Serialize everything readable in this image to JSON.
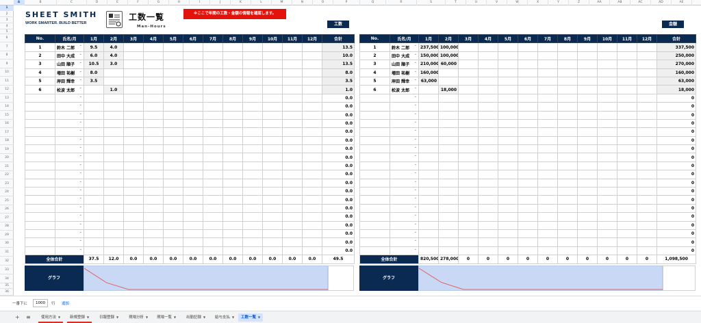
{
  "column_headers": [
    "A",
    "B",
    "C",
    "D",
    "E",
    "F",
    "G",
    "H",
    "I",
    "J",
    "K",
    "L",
    "M",
    "N",
    "O",
    "P",
    "Q",
    "R",
    "S",
    "T",
    "U",
    "V",
    "W",
    "X",
    "Y",
    "Z",
    "AA",
    "AB",
    "AC",
    "AD",
    "AE",
    "AF"
  ],
  "row_count": 36,
  "brand": {
    "name": "SHEET SMITH",
    "tagline": "WORK SMARTER. BUILD BETTER"
  },
  "page_title": {
    "ja": "工数一覧",
    "en": "Man-Hours"
  },
  "notice": "※ここで年間の工数・金額の情報を確認します。",
  "left_tag": "工数",
  "right_tag": "金額",
  "headers": {
    "no": "No.",
    "name": "氏名/月",
    "months": [
      "1月",
      "2月",
      "3月",
      "4月",
      "5月",
      "6月",
      "7月",
      "8月",
      "9月",
      "10月",
      "11月",
      "12月"
    ],
    "total": "合計"
  },
  "hours_rows": [
    {
      "no": "1",
      "name": "鈴木 二郎",
      "m": [
        "9.5",
        "4.0",
        "",
        "",
        "",
        "",
        "",
        "",
        "",
        "",
        "",
        ""
      ],
      "total": "13.5"
    },
    {
      "no": "2",
      "name": "田中 大成",
      "m": [
        "6.0",
        "4.0",
        "",
        "",
        "",
        "",
        "",
        "",
        "",
        "",
        "",
        ""
      ],
      "total": "10.0"
    },
    {
      "no": "3",
      "name": "山田 順子",
      "m": [
        "10.5",
        "3.0",
        "",
        "",
        "",
        "",
        "",
        "",
        "",
        "",
        "",
        ""
      ],
      "total": "13.5"
    },
    {
      "no": "4",
      "name": "増田 祐樹",
      "m": [
        "8.0",
        "",
        "",
        "",
        "",
        "",
        "",
        "",
        "",
        "",
        "",
        ""
      ],
      "total": "8.0"
    },
    {
      "no": "5",
      "name": "岸田 輝幸",
      "m": [
        "3.5",
        "",
        "",
        "",
        "",
        "",
        "",
        "",
        "",
        "",
        "",
        ""
      ],
      "total": "3.5"
    },
    {
      "no": "6",
      "name": "松波 太郎",
      "m": [
        "",
        "1.0",
        "",
        "",
        "",
        "",
        "",
        "",
        "",
        "",
        "",
        ""
      ],
      "total": "1.0"
    }
  ],
  "hours_empty_total": "0.0",
  "amount_rows": [
    {
      "no": "1",
      "name": "鈴木 二郎",
      "m": [
        "237,500",
        "100,000",
        "",
        "",
        "",
        "",
        "",
        "",
        "",
        "",
        "",
        ""
      ],
      "total": "337,500"
    },
    {
      "no": "2",
      "name": "田中 大成",
      "m": [
        "150,000",
        "100,000",
        "",
        "",
        "",
        "",
        "",
        "",
        "",
        "",
        "",
        ""
      ],
      "total": "250,000"
    },
    {
      "no": "3",
      "name": "山田 順子",
      "m": [
        "210,000",
        "60,000",
        "",
        "",
        "",
        "",
        "",
        "",
        "",
        "",
        "",
        ""
      ],
      "total": "270,000"
    },
    {
      "no": "4",
      "name": "増田 祐樹",
      "m": [
        "160,000",
        "",
        "",
        "",
        "",
        "",
        "",
        "",
        "",
        "",
        "",
        ""
      ],
      "total": "160,000"
    },
    {
      "no": "5",
      "name": "岸田 輝幸",
      "m": [
        "63,000",
        "",
        "",
        "",
        "",
        "",
        "",
        "",
        "",
        "",
        "",
        ""
      ],
      "total": "63,000"
    },
    {
      "no": "6",
      "name": "松波 太郎",
      "m": [
        "",
        "18,000",
        "",
        "",
        "",
        "",
        "",
        "",
        "",
        "",
        "",
        ""
      ],
      "total": "18,000"
    }
  ],
  "amount_empty_total": "0",
  "empty_row_count": 19,
  "sum_label": "全体合計",
  "hours_sums": [
    "37.5",
    "12.0",
    "0.0",
    "0.0",
    "0.0",
    "0.0",
    "0.0",
    "0.0",
    "0.0",
    "0.0",
    "0.0",
    "0.0"
  ],
  "hours_grand_total": "49.5",
  "amount_sums": [
    "820,500",
    "278,000",
    "0",
    "0",
    "0",
    "0",
    "0",
    "0",
    "0",
    "0",
    "0",
    "0"
  ],
  "amount_grand_total": "1,098,500",
  "graph_label": "グラフ",
  "hours_graph_values": [
    37.5,
    12.0,
    0,
    0,
    0,
    0,
    0,
    0,
    0,
    0,
    0,
    0
  ],
  "amount_graph_values": [
    820500,
    278000,
    0,
    0,
    0,
    0,
    0,
    0,
    0,
    0,
    0,
    0
  ],
  "graph_line_color": "#e06666",
  "bottom": {
    "prefix": "一番下に",
    "rows": "1000",
    "suffix": "行",
    "add": "追加"
  },
  "sheet_tabs": [
    "使用方法",
    "新規登録",
    "日報登録",
    "現場分析",
    "現場一覧",
    "出勤記録",
    "給与支払",
    "工数一覧"
  ],
  "active_tab": "工数一覧",
  "colors": {
    "navy": "#0a2a52",
    "red": "#e3120b",
    "graph_fill": "#c9d8f5"
  }
}
